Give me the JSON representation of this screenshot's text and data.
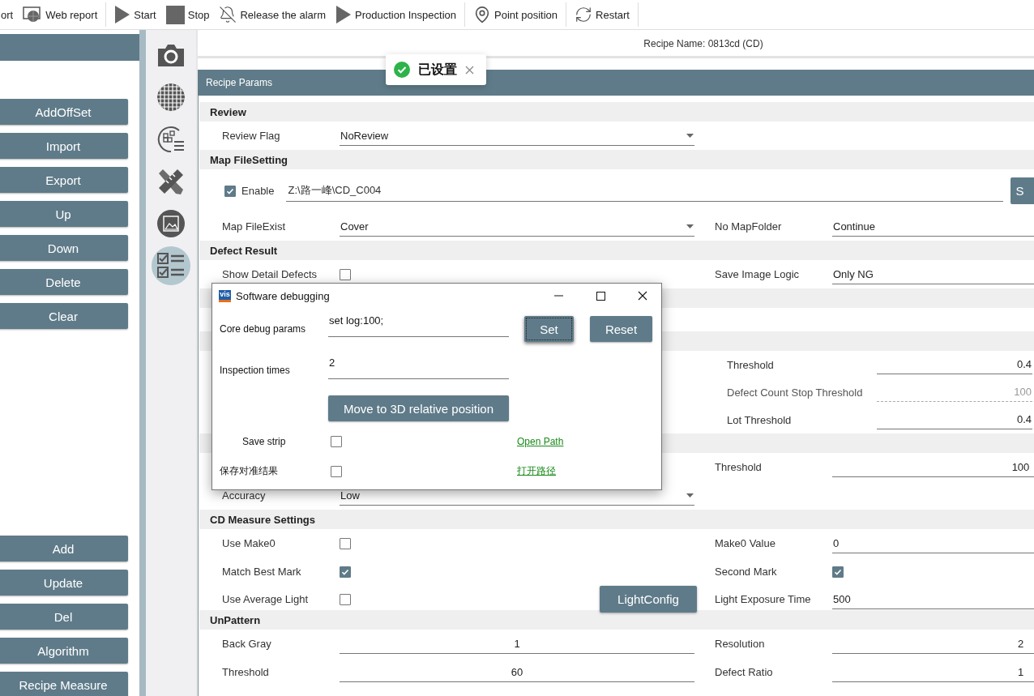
{
  "toolbar": [
    {
      "kind": "clipped",
      "label": "ort",
      "separator_after": false
    },
    {
      "kind": "web",
      "label": "Web report",
      "separator_after": true
    },
    {
      "kind": "play",
      "label": "Start",
      "separator_after": false
    },
    {
      "kind": "stop",
      "label": "Stop",
      "separator_after": false
    },
    {
      "kind": "bell-off",
      "label": "Release the alarm",
      "separator_after": false
    },
    {
      "kind": "play",
      "label": "Production Inspection",
      "separator_after": true
    },
    {
      "kind": "pin",
      "label": "Point position",
      "separator_after": true
    },
    {
      "kind": "restart",
      "label": "Restart",
      "separator_after": true
    }
  ],
  "sidebar": {
    "top_buttons": [
      "AddOffSet",
      "Import",
      "Export",
      "Up",
      "Down",
      "Delete",
      "Clear"
    ],
    "bottom_buttons": [
      "Add",
      "Update",
      "Del",
      "Algorithm",
      "Recipe Measure"
    ]
  },
  "tool_rail": [
    {
      "kind": "camera",
      "selected": false
    },
    {
      "kind": "wafer",
      "selected": false
    },
    {
      "kind": "wafer-list",
      "selected": false
    },
    {
      "kind": "ruler",
      "selected": false
    },
    {
      "kind": "image",
      "selected": false
    },
    {
      "kind": "checklist",
      "selected": true
    }
  ],
  "recipe_name": "Recipe Name: 0813cd (CD)",
  "toast": {
    "text": "已设置"
  },
  "panel": {
    "title": "Recipe Params",
    "sections": [
      {
        "title": "Review",
        "rows": [
          {
            "kind": "pair",
            "left": {
              "kind": "dropdown",
              "label": "Review Flag",
              "value": "NoReview"
            }
          }
        ]
      },
      {
        "title": "Map FileSetting",
        "rows": [
          {
            "kind": "path",
            "checked": true,
            "label": "Enable",
            "value": "Z:\\路一峰\\CD_C004",
            "button": "S"
          },
          {
            "kind": "pair",
            "left": {
              "kind": "dropdown",
              "label": "Map FileExist",
              "value": "Cover"
            },
            "right": {
              "kind": "field",
              "label": "No MapFolder",
              "value": "Continue"
            }
          }
        ]
      },
      {
        "title": "Defect Result",
        "rows": [
          {
            "kind": "pair",
            "left": {
              "kind": "check",
              "label": "Show Detail Defects",
              "checked": false
            },
            "right": {
              "kind": "field",
              "label": "Save Image Logic",
              "value": "Only NG"
            }
          }
        ]
      },
      {
        "rows": [
          {
            "kind": "blank"
          }
        ]
      },
      {
        "rows": [
          {
            "kind": "indented",
            "right": {
              "label": "Threshold",
              "value": "0.4",
              "disabled": false
            }
          },
          {
            "kind": "indented",
            "right": {
              "label": "Defect Count Stop Threshold",
              "value": "100",
              "disabled": true
            }
          },
          {
            "kind": "indented",
            "right": {
              "label": "Lot Threshold",
              "value": "0.4",
              "disabled": false
            }
          }
        ]
      },
      {
        "rows": [
          {
            "kind": "pair",
            "right": {
              "kind": "number",
              "label": "Threshold",
              "value": "100"
            }
          },
          {
            "kind": "pair",
            "left": {
              "kind": "dropdown",
              "label": "Accuracy",
              "value": "Low"
            }
          }
        ]
      },
      {
        "title": "CD Measure Settings",
        "rows": [
          {
            "kind": "pair",
            "left": {
              "kind": "check",
              "label": "Use Make0",
              "checked": false
            },
            "right": {
              "kind": "field",
              "label": "Make0 Value",
              "value": "0"
            }
          },
          {
            "kind": "pair",
            "left": {
              "kind": "check",
              "label": "Match Best Mark",
              "checked": true
            },
            "right": {
              "kind": "check",
              "label": "Second Mark",
              "checked": true
            }
          },
          {
            "kind": "pair",
            "left": {
              "kind": "check",
              "label": "Use Average Light",
              "checked": false,
              "button": "LightConfig"
            },
            "right": {
              "kind": "field",
              "label": "Light Exposure Time",
              "value": "500"
            }
          }
        ]
      },
      {
        "title": "UnPattern",
        "rows": [
          {
            "kind": "pair",
            "left": {
              "kind": "number",
              "label": "Back Gray",
              "value": "1"
            },
            "right": {
              "kind": "number",
              "label": "Resolution",
              "value": "2"
            }
          },
          {
            "kind": "pair",
            "left": {
              "kind": "number",
              "label": "Threshold",
              "value": "60"
            },
            "right": {
              "kind": "number",
              "label": "Defect Ratio",
              "value": "1"
            }
          }
        ]
      }
    ]
  },
  "dialog": {
    "title": "Software debugging",
    "logo": "vis",
    "fields": [
      {
        "label": "Core debug params",
        "value": "set log:100;"
      },
      {
        "label": "Inspection times",
        "value": "2"
      }
    ],
    "buttons": [
      {
        "label": "Set",
        "focused": true
      },
      {
        "label": "Reset",
        "focused": false
      }
    ],
    "action": "Move to 3D relative position",
    "options": [
      {
        "kind": "indented",
        "label": "Save strip",
        "checked": false,
        "link": "Open Path"
      },
      {
        "kind": "plain",
        "label": "保存对准结果",
        "checked": false,
        "link": "打开路径"
      }
    ]
  }
}
